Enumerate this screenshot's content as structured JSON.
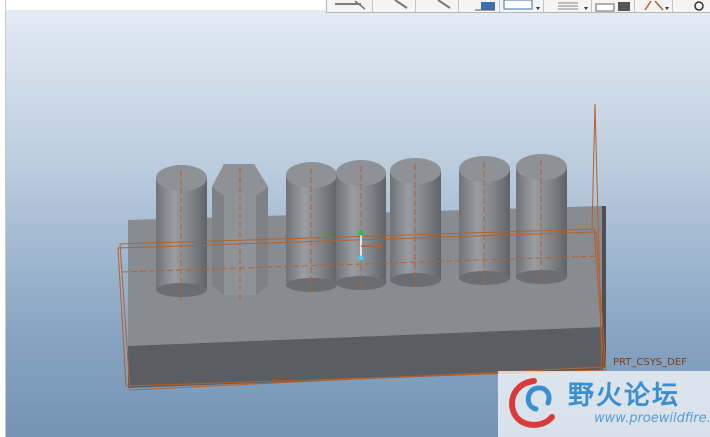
{
  "toolbar": {
    "buttons": [
      {
        "name": "zoom-in-icon",
        "label": ""
      },
      {
        "name": "zoom-out-icon",
        "label": ""
      },
      {
        "name": "refit-icon",
        "label": ""
      },
      {
        "name": "reorient-icon",
        "label": ""
      },
      {
        "name": "saved-views-icon",
        "label": ""
      },
      {
        "name": "display-style-icon",
        "label": ""
      },
      {
        "name": "view-manager-icon",
        "label": ""
      },
      {
        "name": "datum-display-icon",
        "label": ""
      },
      {
        "name": "annotation-display-icon",
        "label": ""
      }
    ]
  },
  "viewport": {
    "csys_label": "PRT_CSYS_DEF",
    "background_top": "#e3ebf3",
    "background_bottom": "#7594b4",
    "model_color": "#8c8f95",
    "datum_color": "#b5612a"
  },
  "watermark": {
    "title": "野火论坛",
    "url": "www.proewildfire.cn"
  }
}
